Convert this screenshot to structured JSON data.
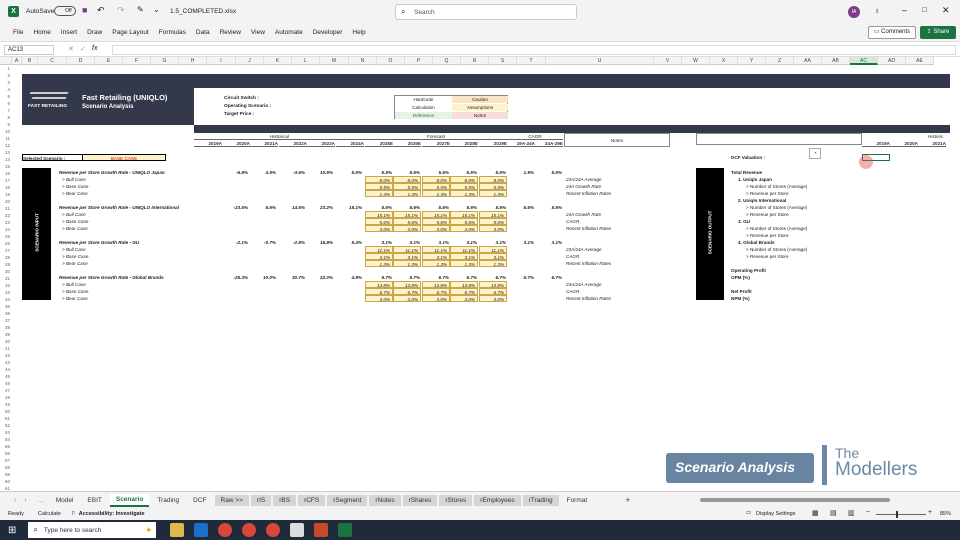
{
  "titlebar": {
    "autosave": "AutoSave",
    "autosave_state": "Off",
    "filename": "1.5_COMPLETED.xlsx",
    "search": "Search",
    "avatar": "IA"
  },
  "ribbon": {
    "tabs": [
      "File",
      "Home",
      "Insert",
      "Draw",
      "Page Layout",
      "Formulas",
      "Data",
      "Review",
      "View",
      "Automate",
      "Developer",
      "Help"
    ],
    "comments": "Comments",
    "share": "Share"
  },
  "formula": {
    "namebox": "AC13",
    "fx": "fx"
  },
  "columns": [
    "A",
    "B",
    "C",
    "D",
    "E",
    "F",
    "G",
    "H",
    "I",
    "J",
    "K",
    "L",
    "M",
    "N",
    "O",
    "P",
    "Q",
    "R",
    "S",
    "T",
    "U",
    "V",
    "W",
    "X",
    "Y",
    "Z",
    "AA",
    "AB",
    "AC",
    "AD",
    "AE"
  ],
  "header": {
    "company": "Fast Retailing (UNIQLO)",
    "subtitle": "Scenario Analysis",
    "logo_text": "FAST RETAILING",
    "circuit": "Circuit Switch :",
    "operating": "Operating Scenario :",
    "target": "Target Price :"
  },
  "legend": {
    "hardcode": "Hardcode",
    "caution": "Caution",
    "calculation": "Calculation",
    "assumptions": "Assumptions",
    "reference": "Reference",
    "notes": "Notes"
  },
  "periods": {
    "historical": "Historical",
    "forecast": "Forecast",
    "cagr": "CAGR",
    "notes": "Notes",
    "historic_right": "Historic"
  },
  "years": [
    "2019A",
    "2020A",
    "2021A",
    "2022A",
    "2023A",
    "2024A",
    "2025E",
    "2026E",
    "2027E",
    "2028E",
    "2029E",
    "19A-24A",
    "24A-29E"
  ],
  "years_right": [
    "2019A",
    "2020A",
    "2021A"
  ],
  "selected_label": "Selected Scenario :",
  "selected_value": "BASE CASE",
  "scenario_input": "SCENARIO INPUT",
  "scenario_output": "SCENARIO OUTPUT",
  "blocks": [
    {
      "title": "Revenue per Store Growth Rate - UNIQLO Japan",
      "hist": [
        "",
        "-6.8%",
        "4.9%",
        "-3.6%",
        "10.6%",
        "5.5%"
      ],
      "fc": [
        "5.5%",
        "5.5%",
        "5.5%",
        "5.5%",
        "5.5%"
      ],
      "cagr": [
        "1.9%",
        "5.5%"
      ],
      "cases": [
        {
          "name": "> Bull Case",
          "v": [
            "8.0%",
            "8.0%",
            "8.0%",
            "8.0%",
            "8.0%"
          ],
          "note": "23A/24A Average"
        },
        {
          "name": "> Base Case",
          "v": [
            "5.5%",
            "5.5%",
            "5.5%",
            "5.5%",
            "5.5%"
          ],
          "note": "24A Growth Rate"
        },
        {
          "name": "> Bear Case",
          "v": [
            "1.3%",
            "1.3%",
            "1.3%",
            "1.3%",
            "1.3%"
          ],
          "note": "Recent Inflation Rates"
        }
      ]
    },
    {
      "title": "Revenue per Store Growth Rate - UNIQLO International",
      "hist": [
        "",
        "-23.5%",
        "5.6%",
        "14.6%",
        "23.2%",
        "15.1%"
      ],
      "fc": [
        "5.6%",
        "5.6%",
        "5.6%",
        "5.6%",
        "5.6%"
      ],
      "cagr": [
        "5.6%",
        "5.6%"
      ],
      "cases": [
        {
          "name": "> Bull Case",
          "v": [
            "15.1%",
            "15.1%",
            "15.1%",
            "15.1%",
            "15.1%"
          ],
          "note": "24A Growth Rate"
        },
        {
          "name": "> Base Case",
          "v": [
            "5.6%",
            "5.6%",
            "5.6%",
            "5.6%",
            "5.6%"
          ],
          "note": "CAGR"
        },
        {
          "name": "> Bear Case",
          "v": [
            "3.0%",
            "3.0%",
            "3.0%",
            "3.0%",
            "3.0%"
          ],
          "note": "Recent Inflation Rates"
        }
      ]
    },
    {
      "title": "Revenue per Store Growth Rate - GU",
      "hist": [
        "",
        "-2.1%",
        "-0.7%",
        "-2.8%",
        "16.8%",
        "5.4%"
      ],
      "fc": [
        "3.1%",
        "3.1%",
        "3.1%",
        "3.1%",
        "3.1%"
      ],
      "cagr": [
        "3.1%",
        "3.1%"
      ],
      "cases": [
        {
          "name": "> Bull Case",
          "v": [
            "11.1%",
            "11.1%",
            "11.1%",
            "11.1%",
            "11.1%"
          ],
          "note": "23A/24A Average"
        },
        {
          "name": "> Base Case",
          "v": [
            "3.1%",
            "3.1%",
            "3.1%",
            "3.1%",
            "3.1%"
          ],
          "note": "CAGR"
        },
        {
          "name": "> Bear Case",
          "v": [
            "1.3%",
            "1.3%",
            "1.3%",
            "1.3%",
            "1.3%"
          ],
          "note": "Recent Inflation Rates"
        }
      ]
    },
    {
      "title": "Revenue per Store Growth Rate - Global Brands",
      "hist": [
        "",
        "-25.3%",
        "10.0%",
        "30.7%",
        "22.0%",
        "4.8%"
      ],
      "fc": [
        "6.7%",
        "6.7%",
        "6.7%",
        "6.7%",
        "6.7%"
      ],
      "cagr": [
        "6.7%",
        "6.7%"
      ],
      "cases": [
        {
          "name": "> Bull Case",
          "v": [
            "13.8%",
            "13.8%",
            "13.8%",
            "13.8%",
            "13.8%"
          ],
          "note": "23A/24A Average"
        },
        {
          "name": "> Base Case",
          "v": [
            "6.7%",
            "6.7%",
            "6.7%",
            "6.7%",
            "6.7%"
          ],
          "note": "CAGR"
        },
        {
          "name": "> Bear Case",
          "v": [
            "3.0%",
            "3.0%",
            "3.0%",
            "3.0%",
            "3.0%"
          ],
          "note": "Recent Inflation Rates"
        }
      ]
    }
  ],
  "output": {
    "dcf": "DCF Valuation :",
    "lines": [
      "Total Revenue",
      "1. Uniqlo Japan",
      "> Number of Stores (Average)",
      "> Revenue per Store",
      "2. Uniqlo International",
      "> Number of Stores (Average)",
      "> Revenue per Store",
      "3. GU",
      "> Number of Stores (Average)",
      "> Revenue per Store",
      "4. Global Brands",
      "> Number of Stores (Average)",
      "> Revenue per Store",
      "",
      "Operating Profit",
      "OPM (%)",
      "",
      "Net Profit",
      "NPM (%)"
    ]
  },
  "watermark": {
    "tag": "Scenario Analysis",
    "brand1": "The",
    "brand2": "Modellers"
  },
  "sheets": [
    {
      "n": "Model",
      "g": false
    },
    {
      "n": "EBIT",
      "g": false
    },
    {
      "n": "Scenario",
      "g": false,
      "a": true
    },
    {
      "n": "Trading",
      "g": false
    },
    {
      "n": "DCF",
      "g": false
    },
    {
      "n": "Raw >>",
      "g": true
    },
    {
      "n": "rIS",
      "g": true
    },
    {
      "n": "rBS",
      "g": true
    },
    {
      "n": "rCFS",
      "g": true
    },
    {
      "n": "rSegment",
      "g": true
    },
    {
      "n": "rNotes",
      "g": true
    },
    {
      "n": "rShares",
      "g": true
    },
    {
      "n": "rStores",
      "g": true
    },
    {
      "n": "rEmployees",
      "g": true
    },
    {
      "n": "rTrading",
      "g": true
    },
    {
      "n": "Format",
      "g": false
    }
  ],
  "status": {
    "ready": "Ready",
    "calculate": "Calculate",
    "accessibility": "Accessibility: Investigate",
    "display": "Display Settings",
    "zoom": "85%"
  },
  "taskbar": {
    "search": "Type here to search"
  }
}
